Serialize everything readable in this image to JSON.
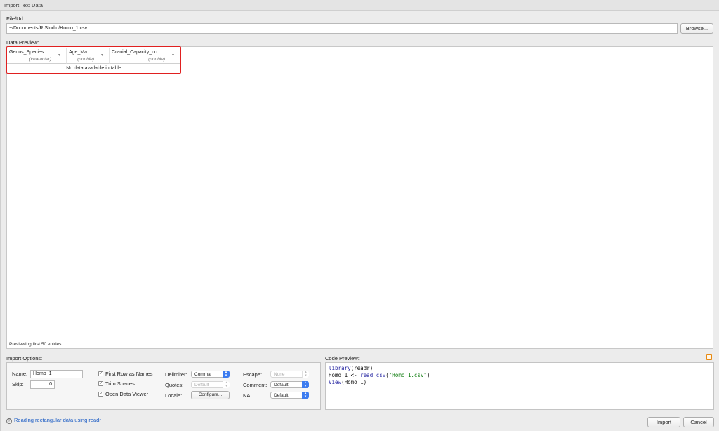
{
  "window": {
    "title": "Import Text Data"
  },
  "file": {
    "label": "File/Url:",
    "value": "~/Documents/R Studio/Homo_1.csv",
    "browse_label": "Browse..."
  },
  "preview": {
    "label": "Data Preview:",
    "columns": [
      {
        "name": "Genus_Species",
        "type": "(character)"
      },
      {
        "name": "Age_Ma",
        "type": "(double)"
      },
      {
        "name": "Cranial_Capacity_cc",
        "type": "(double)"
      }
    ],
    "empty_text": "No data available in table",
    "status": "Previewing first 50 entries."
  },
  "options": {
    "label": "Import Options:",
    "name_label": "Name:",
    "name_value": "Homo_1",
    "skip_label": "Skip:",
    "skip_value": "0",
    "first_row_label": "First Row as Names",
    "trim_label": "Trim Spaces",
    "open_viewer_label": "Open Data Viewer",
    "delimiter_label": "Delimiter:",
    "delimiter_value": "Comma",
    "quotes_label": "Quotes:",
    "quotes_value": "Default",
    "locale_label": "Locale:",
    "locale_button": "Configure...",
    "escape_label": "Escape:",
    "escape_value": "None",
    "comment_label": "Comment:",
    "comment_value": "Default",
    "na_label": "NA:",
    "na_value": "Default"
  },
  "code": {
    "label": "Code Preview:",
    "line1_fn": "library",
    "line1_rest": "(readr)",
    "line2_a": "Homo_1 <- ",
    "line2_fn": "read_csv",
    "line2_b": "(",
    "line2_str": "\"Homo_1.csv\"",
    "line2_c": ")",
    "line3_fn": "View",
    "line3_rest": "(Homo_1)"
  },
  "footer": {
    "help_icon": "?",
    "link_text": "Reading rectangular data using readr",
    "import_label": "Import",
    "cancel_label": "Cancel"
  },
  "colors": {
    "highlight": "#e02020",
    "select_accent": "#3c7cf0",
    "link": "#1a5bc4"
  }
}
